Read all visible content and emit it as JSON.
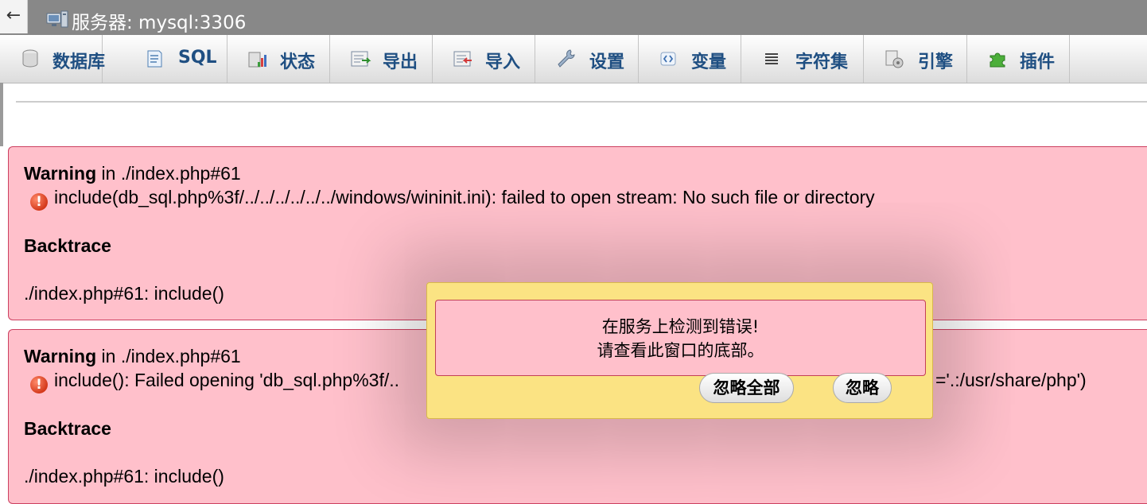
{
  "titlebar": {
    "back_glyph": "←",
    "title": "服务器: mysql:3306",
    "icon": "server-icon"
  },
  "tabs": [
    {
      "label": "数据库",
      "icon": "database-icon"
    },
    {
      "label": "SQL",
      "icon": "sql-icon"
    },
    {
      "label": "状态",
      "icon": "status-icon"
    },
    {
      "label": "导出",
      "icon": "export-icon"
    },
    {
      "label": "导入",
      "icon": "import-icon"
    },
    {
      "label": "设置",
      "icon": "wrench-icon"
    },
    {
      "label": "变量",
      "icon": "variables-icon"
    },
    {
      "label": "字符集",
      "icon": "charset-icon"
    },
    {
      "label": "引擎",
      "icon": "engine-icon"
    },
    {
      "label": "插件",
      "icon": "plugin-icon"
    }
  ],
  "errors": [
    {
      "warning_label": "Warning",
      "location": " in ./index.php#61",
      "message": "include(db_sql.php%3f/../../../../../../windows/wininit.ini): failed to open stream: No such file or directory",
      "backtrace_label": "Backtrace",
      "backtrace": "./index.php#61: include()"
    },
    {
      "warning_label": "Warning",
      "location": " in ./index.php#61",
      "message": "include(): Failed opening 'db_sql.php%3f/..",
      "message_tail": "='.:/usr/share/php')",
      "backtrace_label": "Backtrace",
      "backtrace": "./index.php#61: include()"
    }
  ],
  "dialog": {
    "line1": "在服务上检测到错误!",
    "line2": "请查看此窗口的底部。",
    "ignore_all_label": "忽略全部",
    "ignore_label": "忽略"
  },
  "colors": {
    "titlebar": "#888888",
    "tab_label": "#1f4f82",
    "error_bg": "#ffc0cb",
    "dialog_bg": "#fbe383"
  }
}
